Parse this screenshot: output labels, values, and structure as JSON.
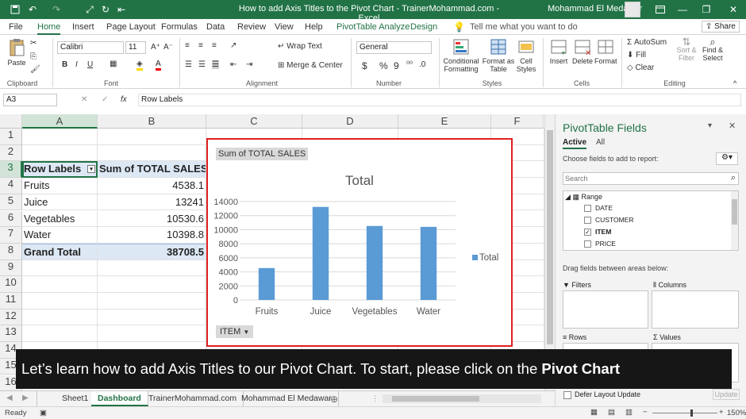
{
  "titlebar": {
    "title": "How to add Axis Titles to the Pivot Chart - TrainerMohammad.com - Excel",
    "user": "Mohammad El Medawar"
  },
  "menu": [
    "File",
    "Home",
    "Insert",
    "Page Layout",
    "Formulas",
    "Data",
    "Review",
    "View",
    "Help",
    "PivotTable Analyze",
    "Design"
  ],
  "tell_me": "Tell me what you want to do",
  "share": "Share",
  "ribbon": {
    "clipboard": {
      "paste": "Paste",
      "label": "Clipboard"
    },
    "font": {
      "name": "Calibri",
      "size": "11",
      "label": "Font",
      "bold": "B",
      "italic": "I",
      "underline": "U"
    },
    "alignment": {
      "wrap": "Wrap Text",
      "merge": "Merge & Center",
      "label": "Alignment"
    },
    "number": {
      "format": "General",
      "dollar": "$",
      "percent": "%",
      "comma": "9",
      "label": "Number"
    },
    "styles": {
      "conditional_1": "Conditional",
      "conditional_2": "Formatting",
      "format_as_1": "Format as",
      "format_as_2": "Table",
      "cell_1": "Cell",
      "cell_2": "Styles",
      "label": "Styles"
    },
    "cells": {
      "insert": "Insert",
      "delete": "Delete",
      "format": "Format",
      "label": "Cells"
    },
    "editing": {
      "autosum": "AutoSum",
      "fill": "Fill",
      "clear": "Clear",
      "sort_1": "Sort &",
      "sort_2": "Filter",
      "find_1": "Find &",
      "find_2": "Select",
      "label": "Editing"
    }
  },
  "formula_bar": {
    "name_box": "A3",
    "content": "Row Labels",
    "fx": "fx"
  },
  "columns": [
    "A",
    "B",
    "C",
    "D",
    "E",
    "F"
  ],
  "rows": [
    "1",
    "2",
    "3",
    "4",
    "5",
    "6",
    "7",
    "8",
    "9",
    "10",
    "11",
    "12",
    "13",
    "14",
    "15",
    "16"
  ],
  "pivot_table": {
    "header": [
      "Row Labels",
      "Sum of TOTAL SALES"
    ],
    "rows": [
      [
        "Fruits",
        "4538.1"
      ],
      [
        "Juice",
        "13241"
      ],
      [
        "Vegetables",
        "10530.6"
      ],
      [
        "Water",
        "10398.8"
      ]
    ],
    "total": [
      "Grand Total",
      "38708.5"
    ]
  },
  "chart_data": {
    "type": "bar",
    "title": "Total",
    "field_button": "Sum of TOTAL SALES",
    "axis_button": "ITEM",
    "categories": [
      "Fruits",
      "Juice",
      "Vegetables",
      "Water"
    ],
    "series": [
      {
        "name": "Total",
        "values": [
          4538.1,
          13241,
          10530.6,
          10398.8
        ]
      }
    ],
    "ylim": [
      0,
      14000
    ],
    "yticks": [
      "0",
      "2000",
      "4000",
      "6000",
      "8000",
      "10000",
      "12000",
      "14000"
    ],
    "grid": true,
    "legend": "right",
    "bar_color": "#5b9bd5"
  },
  "pane": {
    "title": "PivotTable Fields",
    "tab_active": "Active",
    "tab_all": "All",
    "choose": "Choose fields to add to report:",
    "search_placeholder": "Search",
    "range": "Range",
    "fields": [
      {
        "name": "DATE",
        "checked": false
      },
      {
        "name": "CUSTOMER",
        "checked": false
      },
      {
        "name": "ITEM",
        "checked": true
      },
      {
        "name": "PRICE",
        "checked": false
      }
    ],
    "drag": "Drag fields between areas below:",
    "filters": "Filters",
    "columns": "Columns",
    "rows": "Rows",
    "values": "Values",
    "defer": "Defer Layout Update",
    "update": "Update"
  },
  "caption": {
    "text": "Let’s learn how to add Axis Titles to our Pivot Chart. To start, please click on the ",
    "bold": "Pivot Chart"
  },
  "sheet_tabs": [
    "Sheet1",
    "Dashboard",
    "TrainerMohammad.com",
    "Mohammad El Medawar"
  ],
  "active_tab": 1,
  "status": {
    "ready": "Ready",
    "zoom": "150%"
  }
}
